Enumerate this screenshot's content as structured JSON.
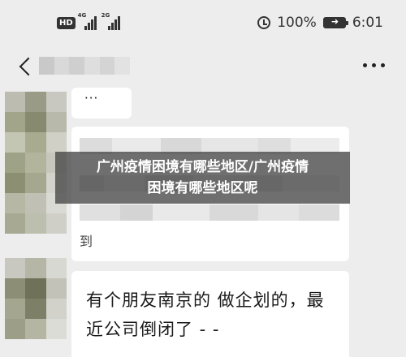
{
  "status_bar": {
    "hd_badge": "HD",
    "sim1_label": "4G",
    "sim2_label": "2G",
    "battery": "100%",
    "time": "6:01"
  },
  "chat": {
    "top_bubble_text": "···",
    "mid_tail_text": "到",
    "bottom_bubble_lines": [
      "有个朋友南京的 做企划的，最",
      "近公司倒闭了 - -"
    ]
  },
  "overlay": {
    "line1": "广州疫情困境有哪些地区/广州疫情",
    "line2": "困境有哪些地区呢"
  },
  "colors": {
    "background": "#ededed",
    "bubble": "#ffffff",
    "overlay": "#464646"
  },
  "icons": [
    "hd-badge-icon",
    "signal-icon",
    "alarm-icon",
    "battery-icon",
    "back-icon",
    "more-icon"
  ]
}
